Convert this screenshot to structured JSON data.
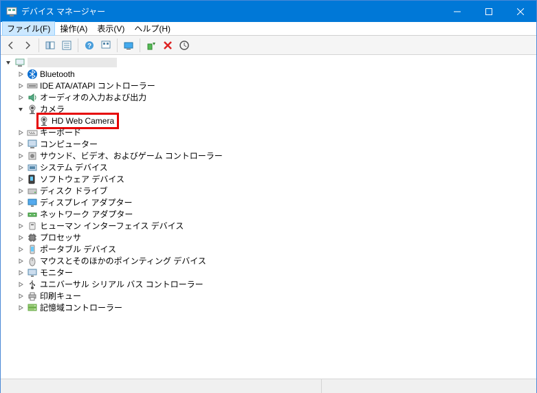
{
  "window": {
    "title": "デバイス マネージャー"
  },
  "menu": {
    "file": "ファイル(F)",
    "action": "操作(A)",
    "view": "表示(V)",
    "help": "ヘルプ(H)"
  },
  "tree": {
    "root": {
      "label": ""
    },
    "categories": [
      {
        "id": "bluetooth",
        "label": "Bluetooth",
        "expanded": false
      },
      {
        "id": "ide",
        "label": "IDE ATA/ATAPI コントローラー",
        "expanded": false
      },
      {
        "id": "audio-io",
        "label": "オーディオの入力および出力",
        "expanded": false
      },
      {
        "id": "camera",
        "label": "カメラ",
        "expanded": true,
        "children": [
          {
            "id": "hd-web-camera",
            "label": "HD Web Camera",
            "highlighted": true
          }
        ]
      },
      {
        "id": "keyboard",
        "label": "キーボード",
        "expanded": false
      },
      {
        "id": "computer",
        "label": "コンピューター",
        "expanded": false
      },
      {
        "id": "sound",
        "label": "サウンド、ビデオ、およびゲーム コントローラー",
        "expanded": false
      },
      {
        "id": "system",
        "label": "システム デバイス",
        "expanded": false
      },
      {
        "id": "software",
        "label": "ソフトウェア デバイス",
        "expanded": false
      },
      {
        "id": "disk",
        "label": "ディスク ドライブ",
        "expanded": false
      },
      {
        "id": "display",
        "label": "ディスプレイ アダプター",
        "expanded": false
      },
      {
        "id": "network",
        "label": "ネットワーク アダプター",
        "expanded": false
      },
      {
        "id": "hid",
        "label": "ヒューマン インターフェイス デバイス",
        "expanded": false
      },
      {
        "id": "processor",
        "label": "プロセッサ",
        "expanded": false
      },
      {
        "id": "portable",
        "label": "ポータブル デバイス",
        "expanded": false
      },
      {
        "id": "mouse",
        "label": "マウスとそのほかのポインティング デバイス",
        "expanded": false
      },
      {
        "id": "monitor",
        "label": "モニター",
        "expanded": false
      },
      {
        "id": "usb",
        "label": "ユニバーサル シリアル バス コントローラー",
        "expanded": false
      },
      {
        "id": "print-queue",
        "label": "印刷キュー",
        "expanded": false
      },
      {
        "id": "storage-ctl",
        "label": "記憶域コントローラー",
        "expanded": false
      }
    ]
  },
  "toolbar": {
    "back": "back",
    "forward": "forward",
    "properties": "properties",
    "list-all": "list-all",
    "help": "help",
    "devices": "devices",
    "monitor": "monitor",
    "scan": "scan",
    "delete": "delete",
    "update": "update"
  },
  "colors": {
    "titlebar": "#0078d7",
    "highlight_border": "#e60000"
  }
}
